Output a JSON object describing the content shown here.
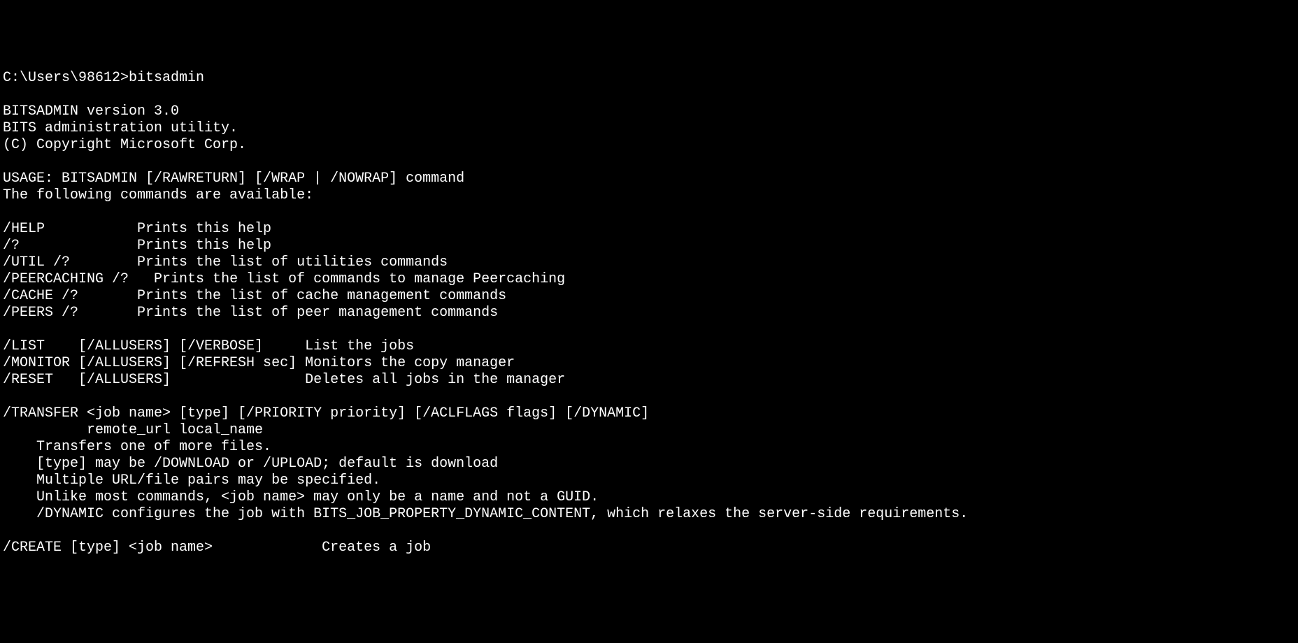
{
  "terminal": {
    "prompt": "C:\\Users\\98612>",
    "command": "bitsadmin",
    "header": {
      "title": "BITSADMIN version 3.0",
      "description": "BITS administration utility.",
      "copyright": "(C) Copyright Microsoft Corp."
    },
    "usage": "USAGE: BITSADMIN [/RAWRETURN] [/WRAP | /NOWRAP] command",
    "commands_intro": "The following commands are available:",
    "help_commands": [
      {
        "cmd": "/HELP",
        "desc": "Prints this help"
      },
      {
        "cmd": "/?",
        "desc": "Prints this help"
      },
      {
        "cmd": "/UTIL /?",
        "desc": "Prints the list of utilities commands"
      },
      {
        "cmd": "/PEERCACHING /?",
        "desc": "Prints the list of commands to manage Peercaching"
      },
      {
        "cmd": "/CACHE /?",
        "desc": "Prints the list of cache management commands"
      },
      {
        "cmd": "/PEERS /?",
        "desc": "Prints the list of peer management commands"
      }
    ],
    "job_commands": [
      {
        "cmd": "/LIST    [/ALLUSERS] [/VERBOSE]",
        "desc": "List the jobs"
      },
      {
        "cmd": "/MONITOR [/ALLUSERS] [/REFRESH sec]",
        "desc": "Monitors the copy manager"
      },
      {
        "cmd": "/RESET   [/ALLUSERS]",
        "desc": "Deletes all jobs in the manager"
      }
    ],
    "transfer": {
      "line1": "/TRANSFER <job name> [type] [/PRIORITY priority] [/ACLFLAGS flags] [/DYNAMIC]",
      "line2": "          remote_url local_name",
      "desc1": "    Transfers one of more files.",
      "desc2": "    [type] may be /DOWNLOAD or /UPLOAD; default is download",
      "desc3": "    Multiple URL/file pairs may be specified.",
      "desc4": "    Unlike most commands, <job name> may only be a name and not a GUID.",
      "desc5": "    /DYNAMIC configures the job with BITS_JOB_PROPERTY_DYNAMIC_CONTENT, which relaxes the server-side requirements."
    },
    "create": {
      "cmd": "/CREATE [type] <job name>",
      "desc": "Creates a job"
    }
  }
}
